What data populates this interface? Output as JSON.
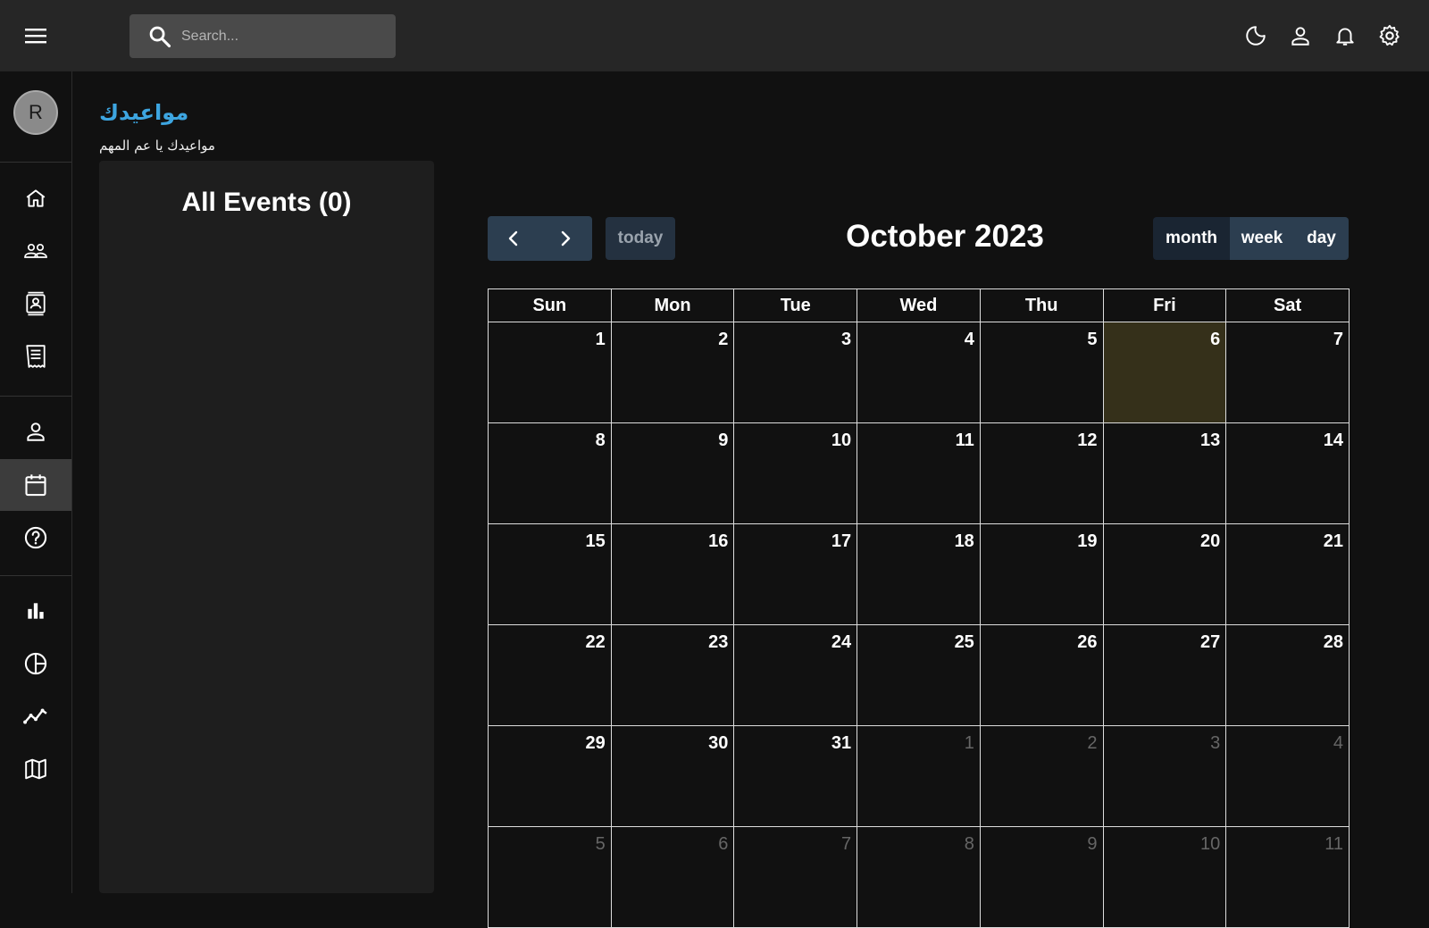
{
  "search": {
    "placeholder": "Search..."
  },
  "topbar": {
    "icons": [
      "moon-icon",
      "person-icon",
      "bell-icon",
      "gear-icon"
    ]
  },
  "sidebar": {
    "avatar_letter": "R",
    "items": [
      {
        "name": "home-icon"
      },
      {
        "name": "team-icon"
      },
      {
        "name": "contacts-icon"
      },
      {
        "name": "invoices-icon"
      },
      {
        "name": "profile-icon"
      },
      {
        "name": "calendar-icon",
        "active": true
      },
      {
        "name": "help-icon"
      },
      {
        "name": "bar-chart-icon"
      },
      {
        "name": "pie-chart-icon"
      },
      {
        "name": "line-chart-icon"
      },
      {
        "name": "map-icon"
      }
    ]
  },
  "header": {
    "title": "مواعيدك",
    "subtitle": "مواعيدك يا عم المهم"
  },
  "events": {
    "title": "All Events (0)"
  },
  "calendar": {
    "title": "October 2023",
    "today_label": "today",
    "views": {
      "month": "month",
      "week": "week",
      "day": "day"
    },
    "weekdays": [
      "Sun",
      "Mon",
      "Tue",
      "Wed",
      "Thu",
      "Fri",
      "Sat"
    ],
    "weeks": [
      [
        "1",
        "2",
        "3",
        "4",
        "5",
        "6",
        "7"
      ],
      [
        "8",
        "9",
        "10",
        "11",
        "12",
        "13",
        "14"
      ],
      [
        "15",
        "16",
        "17",
        "18",
        "19",
        "20",
        "21"
      ],
      [
        "22",
        "23",
        "24",
        "25",
        "26",
        "27",
        "28"
      ],
      [
        "29",
        "30",
        "31",
        "1",
        "2",
        "3",
        "4"
      ],
      [
        "5",
        "6",
        "7",
        "8",
        "9",
        "10",
        "11"
      ]
    ],
    "today_date": "6",
    "colors": {
      "accent": "#3da5e0",
      "today_bg": "#35301a",
      "button": "#2c3e50"
    }
  }
}
